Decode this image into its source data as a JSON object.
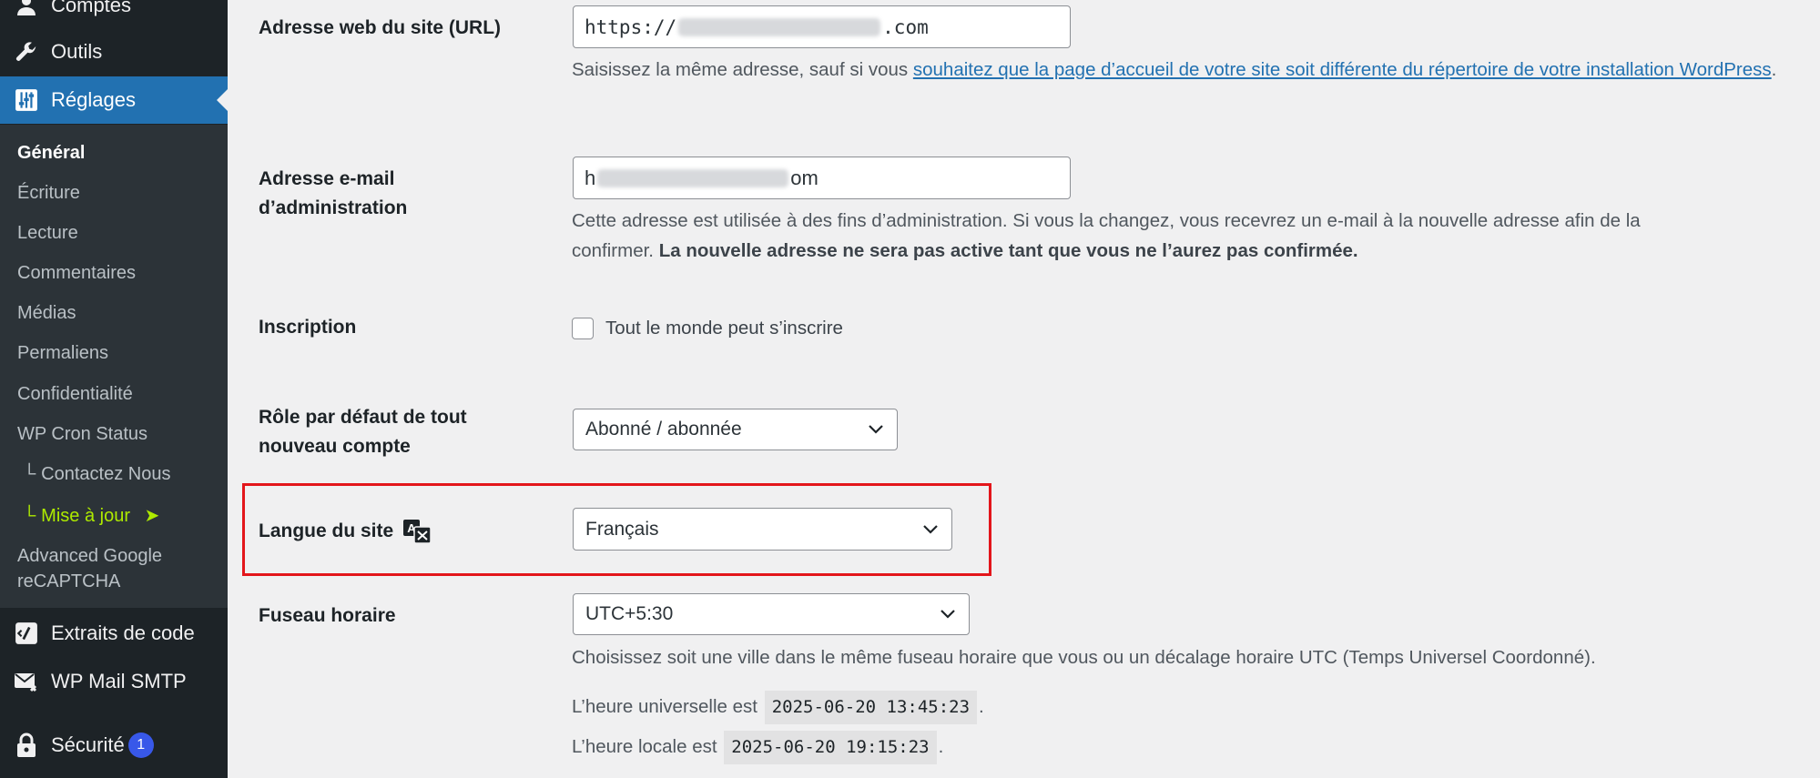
{
  "sidebar": {
    "menu_top": [
      {
        "label": "Comptes",
        "icon": "user-icon"
      },
      {
        "label": "Outils",
        "icon": "wrench-icon"
      },
      {
        "label": "Réglages",
        "icon": "settings-sliders-icon",
        "current": true
      }
    ],
    "submenu": [
      {
        "label": "Général",
        "active": true
      },
      {
        "label": "Écriture"
      },
      {
        "label": "Lecture"
      },
      {
        "label": "Commentaires"
      },
      {
        "label": "Médias"
      },
      {
        "label": "Permaliens"
      },
      {
        "label": "Confidentialité"
      },
      {
        "label": "WP Cron Status"
      },
      {
        "prefix": "└",
        "label": "Contactez Nous"
      },
      {
        "prefix": "└",
        "label": "Mise à jour",
        "suffix": "➤",
        "color": "#aeea00"
      },
      {
        "label_line1": "Advanced Google",
        "label_line2": "reCAPTCHA"
      }
    ],
    "menu_bottom": [
      {
        "label": "Extraits de code",
        "icon": "code-snippets-icon"
      },
      {
        "label": "WP Mail SMTP",
        "icon": "mail-icon"
      },
      {
        "label": "Sécurité",
        "icon": "lock-icon",
        "badge": "1"
      }
    ]
  },
  "settings": {
    "site_url": {
      "label": "Adresse web du site (URL)",
      "value_prefix": "https://",
      "value_suffix": ".com",
      "desc_before": "Saisissez la même adresse, sauf si vous ",
      "desc_link": "souhaitez que la page d’accueil de votre site soit différente du répertoire de votre installation WordPress",
      "desc_after": "."
    },
    "admin_email": {
      "label_line1": "Adresse e-mail",
      "label_line2": "d’administration",
      "value_prefix": "h",
      "value_suffix": "om",
      "desc_line1": "Cette adresse est utilisée à des fins d’administration. Si vous la changez, vous recevrez un e-mail à la nouvelle adresse afin de la",
      "desc_line2_plain": "confirmer. ",
      "desc_line2_bold": "La nouvelle adresse ne sera pas active tant que vous ne l’aurez pas confirmée."
    },
    "membership": {
      "label": "Inscription",
      "checkbox_label": "Tout le monde peut s’inscrire",
      "checked": false
    },
    "default_role": {
      "label_line1": "Rôle par défaut de tout",
      "label_line2": "nouveau compte",
      "selected": "Abonné / abonnée"
    },
    "site_language": {
      "label": "Langue du site",
      "icon": "translation-icon",
      "selected": "Français",
      "highlight_color": "#e3161b"
    },
    "timezone": {
      "label": "Fuseau horaire",
      "selected": "UTC+5:30",
      "desc": "Choisissez soit une ville dans le même fuseau horaire que vous ou un décalage horaire UTC (Temps Universel Coordonné).",
      "utc_label": "L’heure universelle est",
      "utc_value": "2025-06-20 13:45:23",
      "local_label": "L’heure locale est",
      "local_value": "2025-06-20 19:15:23",
      "period": "."
    }
  },
  "colors": {
    "sidebar_bg": "#1d2327",
    "submenu_bg": "#2c3338",
    "accent": "#2271b1",
    "badge": "#3858e9"
  }
}
